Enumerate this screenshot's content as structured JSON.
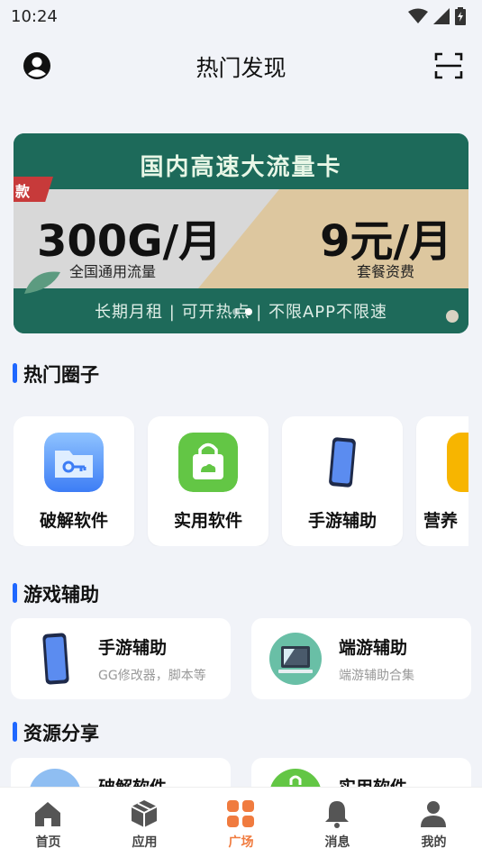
{
  "status": {
    "time": "10:24"
  },
  "header": {
    "title": "热门发现"
  },
  "banner": {
    "headline": "国内高速大流量卡",
    "tag": "款",
    "left_big": "300G/月",
    "left_sub": "全国通用流量",
    "right_big": "9元/月",
    "right_sub": "套餐资费",
    "slogan": "长期月租 | 可开热点 | 不限APP不限速",
    "active_slide": 2
  },
  "sections": {
    "hot_circles": "热门圈子",
    "game_assist": "游戏辅助",
    "resource_share": "资源分享"
  },
  "circles": [
    {
      "label": "破解软件",
      "icon": "folder-key-icon"
    },
    {
      "label": "实用软件",
      "icon": "shopping-bag-icon"
    },
    {
      "label": "手游辅助",
      "icon": "phone-icon"
    },
    {
      "label": "营养",
      "icon": "yellow-app-icon"
    }
  ],
  "game_tiles": [
    {
      "title": "手游辅助",
      "subtitle": "GG修改器，脚本等",
      "icon": "phone-icon"
    },
    {
      "title": "端游辅助",
      "subtitle": "端游辅助合集",
      "icon": "monitor-icon"
    }
  ],
  "resource_tiles": [
    {
      "title": "破解软件",
      "icon": "folder-icon"
    },
    {
      "title": "实用软件",
      "icon": "bag-icon"
    }
  ],
  "tabs": [
    {
      "label": "首页",
      "icon": "home-icon"
    },
    {
      "label": "应用",
      "icon": "box-icon"
    },
    {
      "label": "广场",
      "icon": "grid-icon",
      "active": true
    },
    {
      "label": "消息",
      "icon": "bell-icon"
    },
    {
      "label": "我的",
      "icon": "user-icon"
    }
  ],
  "colors": {
    "accent": "#1f67ff",
    "active_tab": "#f07b3f",
    "banner_green": "#1e6a5a"
  }
}
